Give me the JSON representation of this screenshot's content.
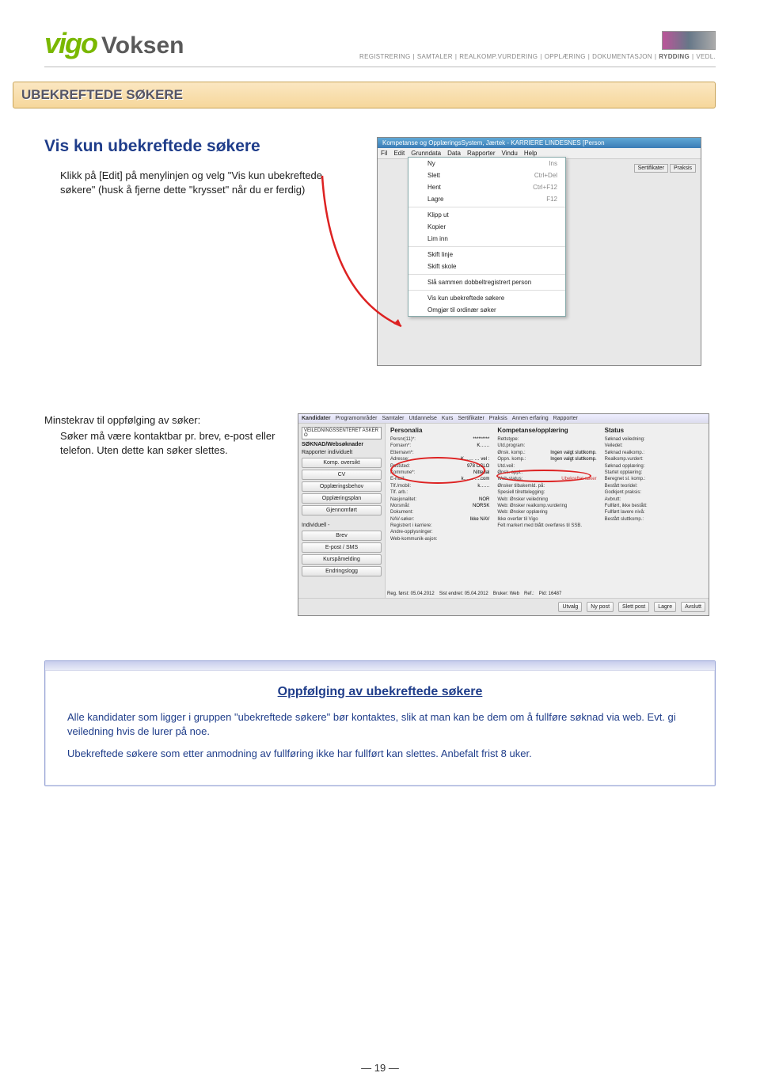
{
  "header": {
    "logo_vi": "vi",
    "logo_go": "go",
    "logo_voksen": "Voksen",
    "breadcrumb": [
      "REGISTRERING",
      "SAMTALER",
      "REALKOMP.VURDERING",
      "OPPLÆRING",
      "DOKUMENTASJON",
      "RYDDING",
      "VEDL."
    ],
    "breadcrumb_active_index": 5
  },
  "section_title": "UBEKREFTEDE SØKERE",
  "heading": "Vis kun ubekreftede søkere",
  "intro_para": "Klikk på [Edit] på menylinjen og velg \"Vis kun ubekreftede søkere\" (husk å fjerne dette \"krysset\" når du er ferdig)",
  "minstekrav_heading": "Minstekrav til oppfølging av søker:",
  "minstekrav_line1": "Søker må være kontaktbar pr. brev, e-post eller telefon.  Uten dette kan søker slettes.",
  "shot1": {
    "title": "Kompetanse og OpplæringsSystem, Jærtek - KARRIERE LINDESNES [Person",
    "menubar": [
      "Fil",
      "Edit",
      "Grunndata",
      "Data",
      "Rapporter",
      "Vindu",
      "Help"
    ],
    "menu_items": [
      {
        "label": "Ny",
        "short": "Ins"
      },
      {
        "label": "Slett",
        "short": "Ctrl+Del"
      },
      {
        "label": "Hent",
        "short": "Ctrl+F12"
      },
      {
        "label": "Lagre",
        "short": "F12"
      },
      {
        "label": "Klipp ut",
        "short": ""
      },
      {
        "label": "Kopier",
        "short": ""
      },
      {
        "label": "Lim inn",
        "short": ""
      },
      {
        "label": "Skift linje",
        "short": ""
      },
      {
        "label": "Skift skole",
        "short": ""
      },
      {
        "label": "Slå sammen dobbeltregistrert person",
        "short": ""
      },
      {
        "label": "Vis kun ubekreftede søkere",
        "short": ""
      },
      {
        "label": "Omgjør til ordinær søker",
        "short": ""
      }
    ],
    "side_tabs": [
      "Sertifikater",
      "Praksis"
    ]
  },
  "shot2": {
    "window_title": "Kandidater",
    "tabs": [
      "Kandidater",
      "Programområder",
      "Samtaler",
      "Utdannelse",
      "Kurs",
      "Sertifikater",
      "Praksis",
      "Annen erfaring",
      "Rapporter"
    ],
    "left_dropdown": "VEILEDNINGSSENTERET ASKER O",
    "left_heading": "SØKNAD/Websøknader",
    "left_sub": "Rapporter individuelt",
    "left_buttons": [
      "Komp. oversikt",
      "CV",
      "Opplæringsbehov",
      "Opplæringsplan",
      "Gjennomført"
    ],
    "left_sub2": "Individuell -",
    "left_buttons2": [
      "Brev",
      "E-post / SMS",
      "Kurspåmelding",
      "Endringslogg"
    ],
    "col_personalia": "Personalia",
    "col_kompetanse": "Kompetanse/opplæring",
    "col_status": "Status",
    "personalia": [
      {
        "k": "Persnr(11)*:",
        "v": "*********"
      },
      {
        "k": "Fornavn*:",
        "v": "K……"
      },
      {
        "k": "Etternavn*:",
        "v": ""
      },
      {
        "k": "Adresse:",
        "v": "K……  … vel :"
      },
      {
        "k": "Poststed:",
        "v": "978   OSLO"
      },
      {
        "k": "Kommune*:",
        "v": "Nittedal"
      },
      {
        "k": "E-mail:",
        "v": "k……  ….com"
      },
      {
        "k": "Tlf./mobil:",
        "v": "k……"
      },
      {
        "k": "Tlf. arb.:",
        "v": ""
      },
      {
        "k": "Nasjonalitet:",
        "v": "NOR"
      },
      {
        "k": "Morsmål:",
        "v": "NORSK"
      },
      {
        "k": "Dokument:",
        "v": ""
      },
      {
        "k": "NAV-søker:",
        "v": "Ikke NAV"
      },
      {
        "k": "Registrert i karriere:",
        "v": ""
      },
      {
        "k": "Andre-opplysninger:",
        "v": ""
      },
      {
        "k": "Web-kommunik-asjon:",
        "v": ""
      }
    ],
    "kompetanse": [
      {
        "k": "Rettstype:",
        "v": ""
      },
      {
        "k": "Utd.program:",
        "v": ""
      },
      {
        "k": "Ønsk. komp.:",
        "v": "Ingen valgt sluttkomp."
      },
      {
        "k": "Oppn. komp.:",
        "v": "Ingen valgt sluttkomp."
      },
      {
        "k": "Utd.veil:",
        "v": ""
      },
      {
        "k": "Ønsk. oppl.:",
        "v": ""
      },
      {
        "k": "Web-status:",
        "v": "Ubekreftet søker"
      },
      {
        "k": "Ønsker tilbakemld. på:",
        "v": ""
      },
      {
        "k": "Spesiell tilrettelegging:",
        "v": ""
      },
      {
        "k": "Web: Ønsker veiledning",
        "v": ""
      },
      {
        "k": "Web: Ønsker realkomp.vurdering",
        "v": ""
      },
      {
        "k": "Web: Ønsker opplæring",
        "v": ""
      },
      {
        "k": "Ikke overfør til Vigo",
        "v": ""
      },
      {
        "k": "Felt markert med blått overføres til SSB.",
        "v": ""
      }
    ],
    "status": [
      "Søknad veiledning:",
      "Veiledet:",
      "Søknad realkomp.:",
      "Realkomp.vurdert:",
      "Søknad opplæring:",
      "Startet opplæring:",
      "Beregnet sl. komp.:",
      "Bestått teoridel:",
      "Godkjent praksis:",
      "Avbrutt:",
      "Fullført, ikke bestått:",
      "Fullført lavere nivå:",
      "Bestått sluttkomp.:"
    ],
    "footer_left": [
      {
        "k": "Reg. først:",
        "v": "05.04.2012"
      },
      {
        "k": "Sist endret:",
        "v": "05.04.2012"
      },
      {
        "k": "Bruker:",
        "v": "Web"
      },
      {
        "k": "Ref.:",
        "v": ""
      },
      {
        "k": "Pid:",
        "v": "16487"
      }
    ],
    "footer_buttons": [
      "Utvalg",
      "Ny post",
      "Slett post",
      "Lagre",
      "Avslutt"
    ]
  },
  "callout": {
    "title": "Oppfølging av ubekreftede søkere",
    "p1": "Alle kandidater som ligger i gruppen \"ubekreftede søkere\" bør kontaktes, slik at man kan be dem om å fullføre søknad via web. Evt. gi veiledning hvis de lurer på noe.",
    "p2": "Ubekreftede  søkere som etter anmodning av fullføring ikke har fullført kan slettes. Anbefalt frist 8 uker."
  },
  "page_number": "— 19 —"
}
